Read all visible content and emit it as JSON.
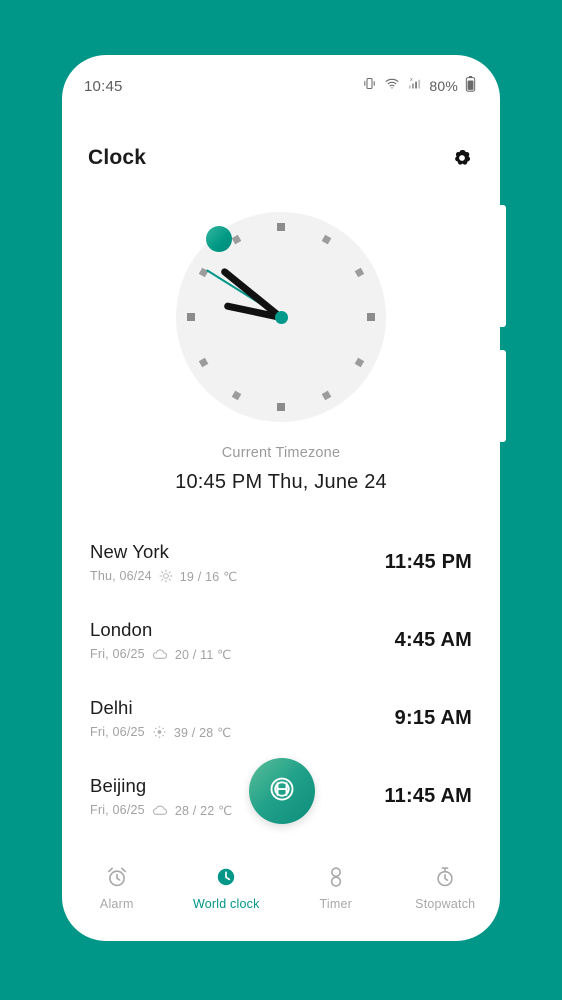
{
  "theme": {
    "background": "#009688",
    "accent": "#009688",
    "surface": "#ffffff",
    "clock_face": "#f2f2f2",
    "muted_text": "#a2a2a2"
  },
  "status_bar": {
    "time": "10:45",
    "battery_percent": "80%",
    "icons": [
      "vibrate-icon",
      "wifi-icon",
      "signal-no-sim-icon",
      "battery-icon"
    ]
  },
  "app_bar": {
    "title": "Clock",
    "settings_icon": "gear-icon"
  },
  "analog_clock": {
    "display_time": "10:45",
    "hour_hand_deg": 142,
    "minute_hand_deg": 122,
    "second_hand_deg": 115,
    "marker_label": "current-city-marker"
  },
  "current_timezone": {
    "label": "Current Timezone",
    "time": "10:45 PM",
    "date": "Thu, June 24",
    "combined": "10:45 PM  Thu, June 24"
  },
  "cities": [
    {
      "name": "New York",
      "date": "Thu, 06/24",
      "weather_icon": "sun-icon",
      "temperature": "19 / 16 ℃",
      "time": "11:45 PM"
    },
    {
      "name": "London",
      "date": "Fri, 06/25",
      "weather_icon": "cloud-icon",
      "temperature": "20 / 11 ℃",
      "time": "4:45 AM"
    },
    {
      "name": "Delhi",
      "date": "Fri, 06/25",
      "weather_icon": "haze-icon",
      "temperature": "39 / 28 ℃",
      "time": "9:15 AM"
    },
    {
      "name": "Beijing",
      "date": "Fri, 06/25",
      "weather_icon": "cloud-icon",
      "temperature": "28 / 22 ℃",
      "time": "11:45 AM"
    }
  ],
  "fab": {
    "icon": "globe-icon",
    "action": "add-city"
  },
  "bottom_nav": {
    "active": "World clock",
    "items": [
      {
        "label": "Alarm",
        "icon": "alarm-clock-icon",
        "active": false
      },
      {
        "label": "World clock",
        "icon": "world-clock-icon",
        "active": true
      },
      {
        "label": "Timer",
        "icon": "hourglass-icon",
        "active": false
      },
      {
        "label": "Stopwatch",
        "icon": "stopwatch-icon",
        "active": false
      }
    ]
  }
}
